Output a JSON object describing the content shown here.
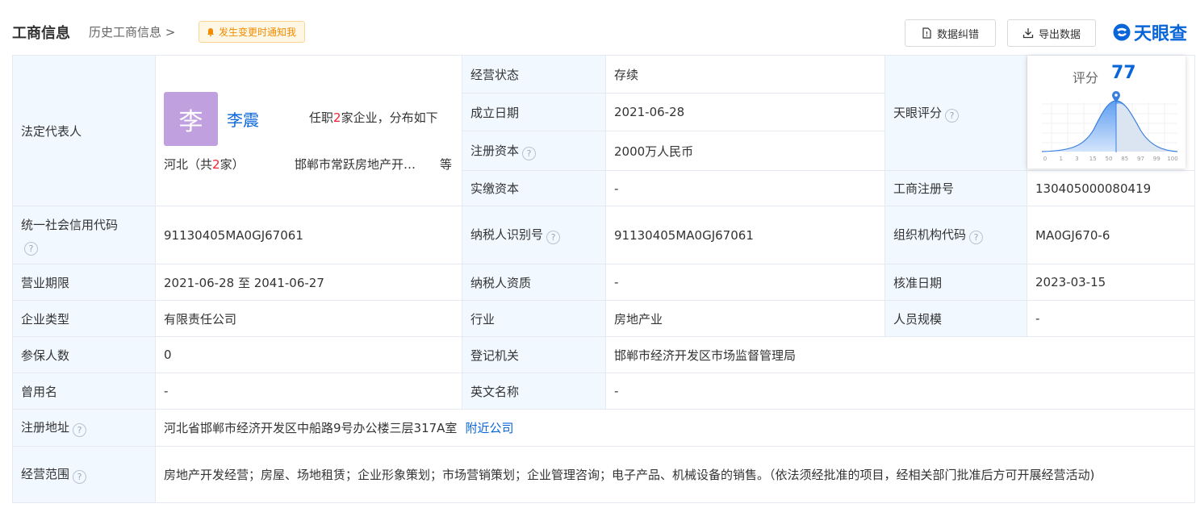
{
  "header": {
    "title": "工商信息",
    "history": "历史工商信息",
    "notify": "发生变更时通知我",
    "btn_correct": "数据纠错",
    "btn_export": "导出数据",
    "logo_text": "天眼查"
  },
  "legal_rep": {
    "label": "法定代表人",
    "avatar_char": "李",
    "name": "李震",
    "pos_pre": "任职",
    "pos_count": "2",
    "pos_post": "家企业，分布如下",
    "region_pre": "河北（共",
    "region_count": "2",
    "region_post": "家）",
    "company": "邯郸市常跃房地产开…",
    "more": "等"
  },
  "rows": {
    "status_l": "经营状态",
    "status_v": "存续",
    "found_l": "成立日期",
    "found_v": "2021-06-28",
    "regcap_l": "注册资本",
    "regcap_v": "2000万人民币",
    "paidcap_l": "实缴资本",
    "paidcap_v": "-",
    "score_l": "天眼评分",
    "regno_l": "工商注册号",
    "regno_v": "130405000080419",
    "credit_l": "统一社会信用代码",
    "credit_v": "91130405MA0GJ67061",
    "taxid_l": "纳税人识别号",
    "taxid_v": "91130405MA0GJ67061",
    "org_l": "组织机构代码",
    "org_v": "MA0GJ670-6",
    "term_l": "营业期限",
    "term_v": "2021-06-28 至 2041-06-27",
    "taxq_l": "纳税人资质",
    "taxq_v": "-",
    "approve_l": "核准日期",
    "approve_v": "2023-03-15",
    "type_l": "企业类型",
    "type_v": "有限责任公司",
    "industry_l": "行业",
    "industry_v": "房地产业",
    "staff_l": "人员规模",
    "staff_v": "-",
    "insured_l": "参保人数",
    "insured_v": "0",
    "authority_l": "登记机关",
    "authority_v": "邯郸市经济开发区市场监督管理局",
    "former_l": "曾用名",
    "former_v": "-",
    "english_l": "英文名称",
    "english_v": "-",
    "addr_l": "注册地址",
    "addr_v": "河北省邯郸市经济开发区中船路9号办公楼三层317A室",
    "addr_link": "附近公司",
    "scope_l": "经营范围",
    "scope_v": "房地产开发经营；房屋、场地租赁；企业形象策划；市场营销策划；企业管理咨询；电子产品、机械设备的销售。（依法须经批准的项目，经相关部门批准后方可开展经营活动)"
  },
  "score": {
    "label": "评分",
    "value": "77",
    "ticks": [
      "0",
      "1",
      "3",
      "15",
      "50",
      "85",
      "97",
      "99",
      "100"
    ],
    "accent": "#0a66d8"
  }
}
